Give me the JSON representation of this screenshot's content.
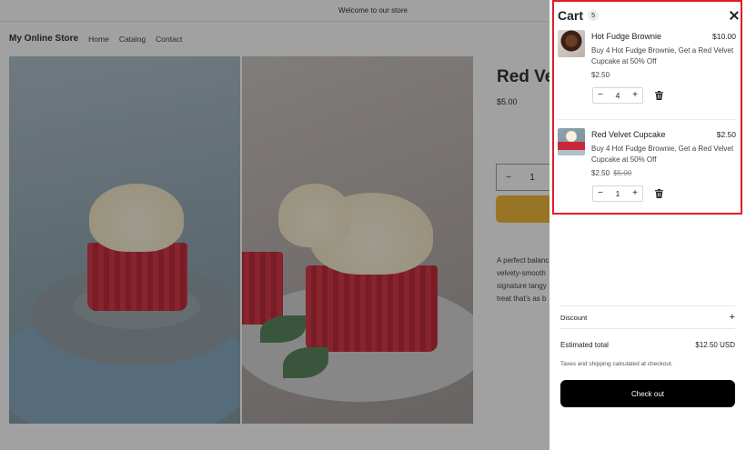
{
  "announcement": "Welcome to our store",
  "store": {
    "name": "My Online Store",
    "nav": [
      "Home",
      "Catalog",
      "Contact"
    ]
  },
  "product": {
    "title": "Red Ve",
    "price": "$5.00",
    "qty": "1",
    "description_lines": [
      "A perfect balanc",
      "velvety-smooth",
      "signature tangy",
      "treat that's as b"
    ]
  },
  "cart": {
    "title": "Cart",
    "count": "5",
    "items": [
      {
        "name": "Hot Fudge Brownie",
        "line_price": "$10.00",
        "offer": "Buy 4 Hot Fudge Brownie, Get a Red Velvet Cupcake at 50% Off",
        "unit_price": "$2.50",
        "original_price": "",
        "quantity": "4"
      },
      {
        "name": "Red Velvet Cupcake",
        "line_price": "$2.50",
        "offer": "Buy 4 Hot Fudge Brownie, Get a Red Velvet Cupcake at 50% Off",
        "unit_price": "$2.50",
        "original_price": "$5.00",
        "quantity": "1"
      }
    ],
    "discount_label": "Discount",
    "estimated_total_label": "Estimated total",
    "estimated_total_value": "$12.50 USD",
    "tax_note": "Taxes and shipping calculated at checkout.",
    "checkout_label": "Check out"
  },
  "colors": {
    "highlight": "#e11d2a",
    "checkout_bg": "#000000",
    "add_to_cart": "#f0b428"
  }
}
